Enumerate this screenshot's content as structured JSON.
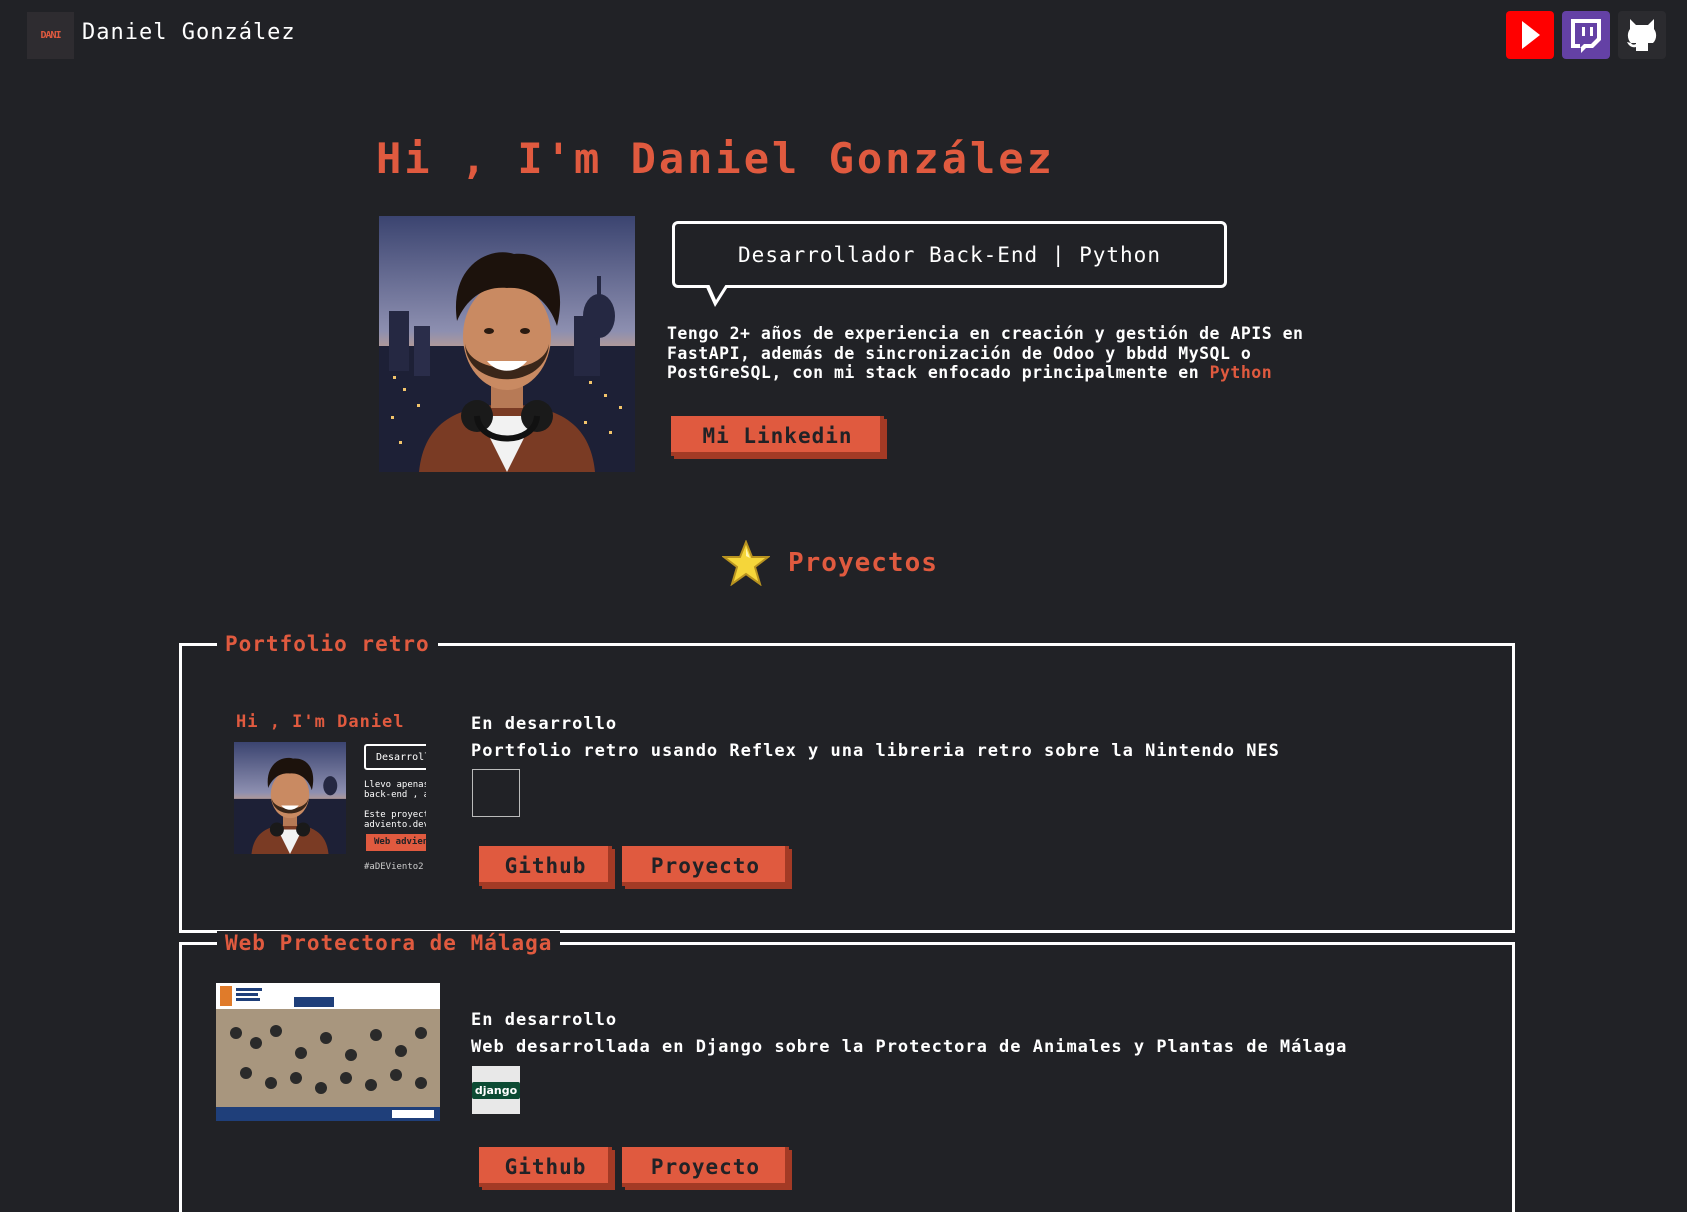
{
  "header": {
    "logo_text": "DANI",
    "brand": "Daniel González",
    "social": [
      {
        "name": "youtube",
        "icon": "youtube-icon",
        "color": "#ff0000"
      },
      {
        "name": "twitch",
        "icon": "twitch-icon",
        "color": "#6441a5"
      },
      {
        "name": "github",
        "icon": "github-icon",
        "color": "#2b2b2f"
      }
    ]
  },
  "hero": {
    "title": "Hi , I'm Daniel González",
    "role": "Desarrollador Back-End | Python",
    "bio_text": "Tengo 2+ años de experiencia en creación y gestión de APIS en FastAPI, además de sincronización de Odoo y bbdd MySQL o PostGreSQL, con mi stack enfocado principalmente en ",
    "bio_highlight": "Python",
    "linkedin_button": "Mi Linkedin"
  },
  "projects_section": {
    "title": "Proyectos",
    "icon": "star-icon"
  },
  "projects": [
    {
      "title": "Portfolio retro",
      "status": "En desarrollo",
      "description": "Portfolio retro usando Reflex y una libreria retro sobre la Nintendo NES",
      "thumbnail": {
        "title": "Hi , I'm Daniel",
        "bubble": "Desarroll",
        "text": "Llevo apenas u\nback-end , aho\n\nEste proyecto\nadviento.dev d",
        "button": "Web advien",
        "tag": "#aDEViento2"
      },
      "github_button": "Github",
      "project_button": "Proyecto"
    },
    {
      "title": "Web Protectora de Málaga",
      "status": "En desarrollo",
      "description": "Web desarrollada en Django sobre la Protectora de Animales y Plantas de Málaga",
      "tech_label": "django",
      "github_button": "Github",
      "project_button": "Proyecto"
    }
  ],
  "colors": {
    "background": "#212226",
    "accent": "#e05a3f",
    "text": "#ffffff"
  }
}
